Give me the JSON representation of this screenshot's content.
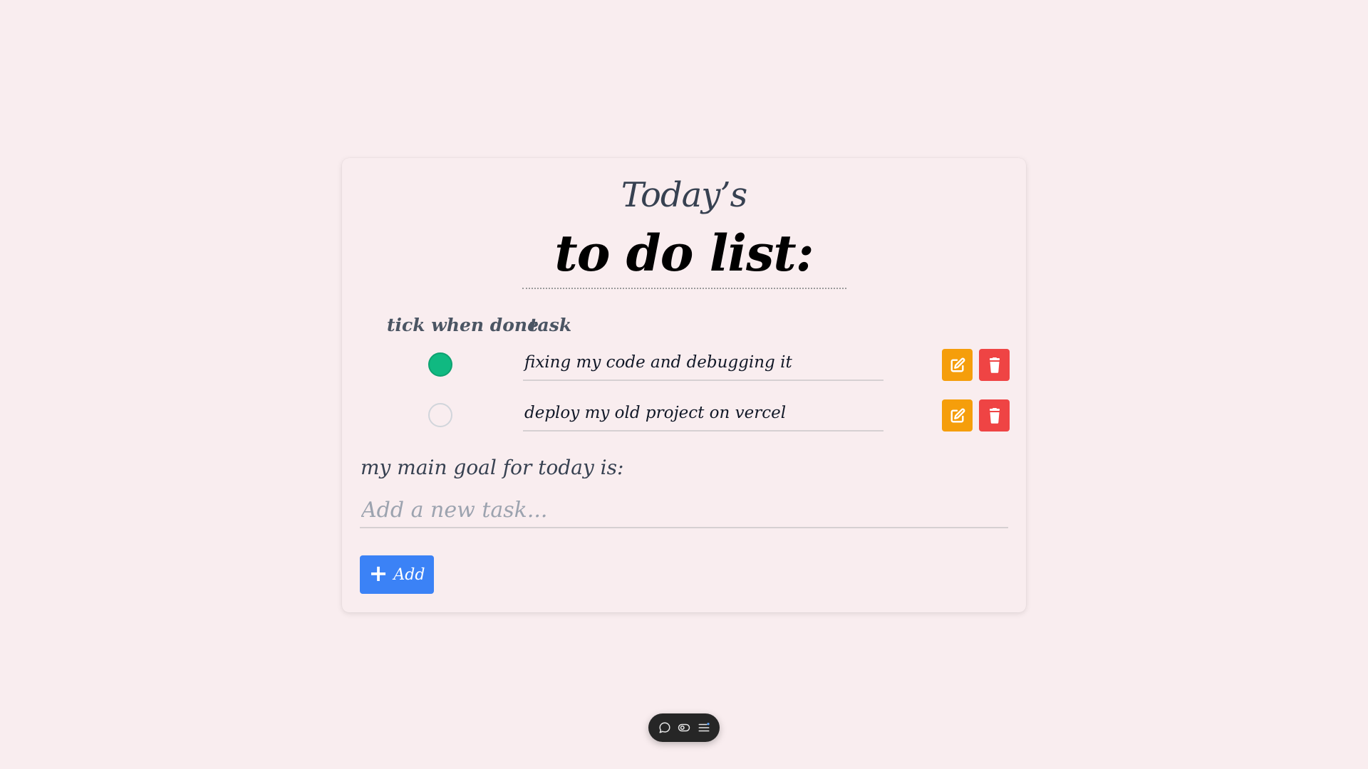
{
  "header": {
    "title_top": "Today’s",
    "title_main": "to do list:"
  },
  "columns": {
    "tick": "tick when done",
    "task": "task"
  },
  "tasks": [
    {
      "text": "fixing my code and debugging it",
      "done": true
    },
    {
      "text": "deploy my old project on vercel",
      "done": false
    }
  ],
  "goal": {
    "label": "my main goal for today is:"
  },
  "new_task": {
    "placeholder": "Add a new task...",
    "value": ""
  },
  "add_button": {
    "label": "Add",
    "icon": "plus-icon"
  },
  "row_actions": {
    "edit_icon": "edit-icon",
    "delete_icon": "trash-icon"
  },
  "toolbar": {
    "icons": [
      "comment-icon",
      "eye-icon",
      "menu-icon"
    ]
  },
  "colors": {
    "background": "#f9edef",
    "done": "#10b981",
    "edit": "#f59e0b",
    "delete": "#ef4444",
    "add": "#3b82f6"
  }
}
